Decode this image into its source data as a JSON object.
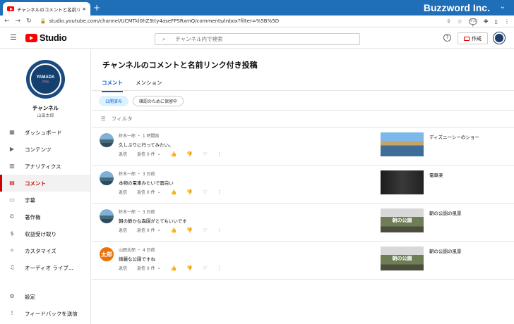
{
  "browser": {
    "tab_title": "チャンネルのコメントと名前リンク付き投稿",
    "new_tab": "+",
    "brand": "Buzzword Inc.",
    "url": "studio.youtube.com/channel/UCMTkl0hZ5tty4aseFPSRxmQ/comments/inbox?filter=%5B%5D",
    "profile_badge": "ゲスト"
  },
  "header": {
    "logo_text": "Studio",
    "search_placeholder": "チャンネル内で検索",
    "create_label": "作成"
  },
  "channel": {
    "avatar_text": "YAMADA",
    "avatar_sub": "blog",
    "name": "チャンネル",
    "owner": "山田太郎"
  },
  "nav": [
    {
      "label": "ダッシュボード",
      "icon": "dashboard-icon"
    },
    {
      "label": "コンテンツ",
      "icon": "content-icon"
    },
    {
      "label": "アナリティクス",
      "icon": "analytics-icon"
    },
    {
      "label": "コメント",
      "icon": "comment-icon"
    },
    {
      "label": "字幕",
      "icon": "subtitles-icon"
    },
    {
      "label": "著作権",
      "icon": "copyright-icon"
    },
    {
      "label": "収益受け取り",
      "icon": "monetization-icon"
    },
    {
      "label": "カスタマイズ",
      "icon": "customize-icon"
    },
    {
      "label": "オーディオ ライブ...",
      "icon": "audio-library-icon"
    }
  ],
  "nav_bottom": [
    {
      "label": "設定",
      "icon": "settings-icon"
    },
    {
      "label": "フィードバックを送信",
      "icon": "feedback-icon"
    }
  ],
  "main": {
    "title": "チャンネルのコメントと名前リンク付き投稿",
    "tabs": [
      "コメント",
      "メンション"
    ],
    "chips": [
      "公開済み",
      "確認のために保留中"
    ],
    "filter_placeholder": "フィルタ"
  },
  "comments": [
    {
      "author_time": "鈴木一郎 ・ 1 時間前",
      "text": "久しぶりに行ってみたい。",
      "reply": "返信",
      "replies": "返信 0 件",
      "video": "ディズニーシーのショー"
    },
    {
      "author_time": "鈴木一郎 ・ 3 日前",
      "text": "本物の電車みたいで面白い",
      "reply": "返信",
      "replies": "返信 0 件",
      "video": "電車楽"
    },
    {
      "author_time": "鈴木一郎 ・ 3 日前",
      "text": "朝の静かな森園がとてもいいです",
      "reply": "返信",
      "replies": "返信 0 件",
      "video": "朝の公園の風景"
    },
    {
      "author_time": "山田太郎 ・ 4 日前",
      "text": "綺麗な公園ですね",
      "reply": "返信",
      "replies": "返信 0 件",
      "video": "朝の公園の風景",
      "avatar_text": "太郎"
    }
  ],
  "thumb_caption": "朝の公園"
}
